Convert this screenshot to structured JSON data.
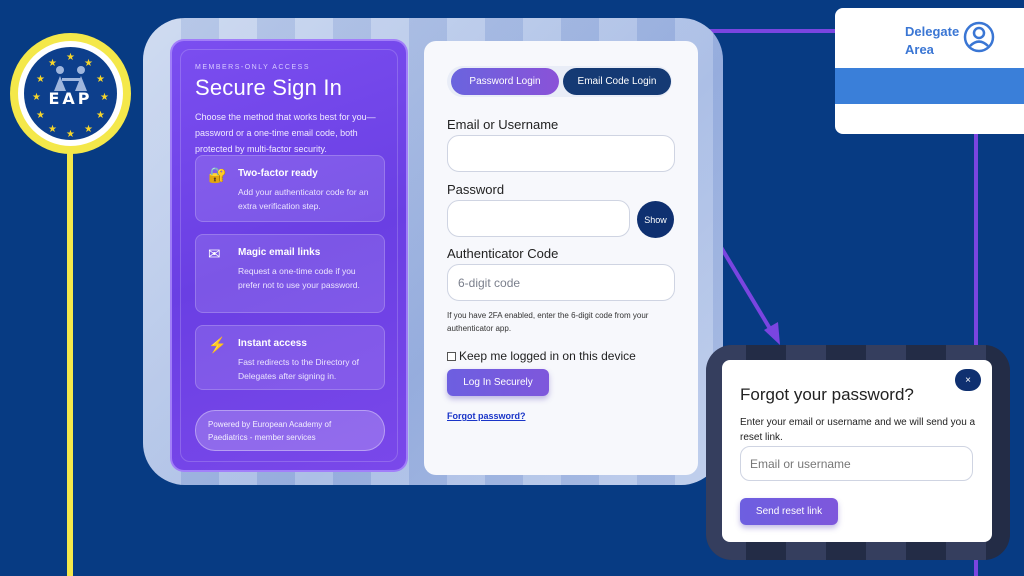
{
  "logo": {
    "text": "EAP"
  },
  "delegate": {
    "label_line1": "Delegate",
    "label_line2": "Area"
  },
  "left_panel": {
    "eyebrow": "MEMBERS-ONLY ACCESS",
    "title": "Secure Sign In",
    "description": "Choose the method that works best for you—password or a one-time email code, both protected by multi-factor security.",
    "features": [
      {
        "icon": "lock-icon",
        "title": "Two-factor ready",
        "desc": "Add your authenticator code for an extra verification step."
      },
      {
        "icon": "envelope-icon",
        "title": "Magic email links",
        "desc": "Request a one-time code if you prefer not to use your password."
      },
      {
        "icon": "lightning-icon",
        "title": "Instant access",
        "desc": "Fast redirects to the Directory of Delegates after signing in."
      }
    ],
    "powered_by": "Powered by European Academy of Paediatrics - member services"
  },
  "login_form": {
    "tabs": [
      "Password Login",
      "Email Code Login"
    ],
    "email_label": "Email or Username",
    "email_value": "",
    "password_label": "Password",
    "password_value": "",
    "show_label": "Show",
    "auth_label": "Authenticator Code",
    "auth_placeholder": "6-digit code",
    "help_text": "If you have 2FA enabled, enter the 6-digit code from your authenticator app.",
    "keep_logged_in": "Keep me logged in on this device",
    "submit": "Log In Securely",
    "forgot_link": "Forgot password?"
  },
  "forgot_modal": {
    "title": "Forgot your password?",
    "close": "×",
    "description": "Enter your email or username and we will send you a reset link.",
    "input_placeholder": "Email or username",
    "submit": "Send reset link"
  },
  "colors": {
    "background": "#073b83",
    "accent_purple": "#7a45e0",
    "yellow": "#f4e84a",
    "navy": "#0f3070"
  }
}
